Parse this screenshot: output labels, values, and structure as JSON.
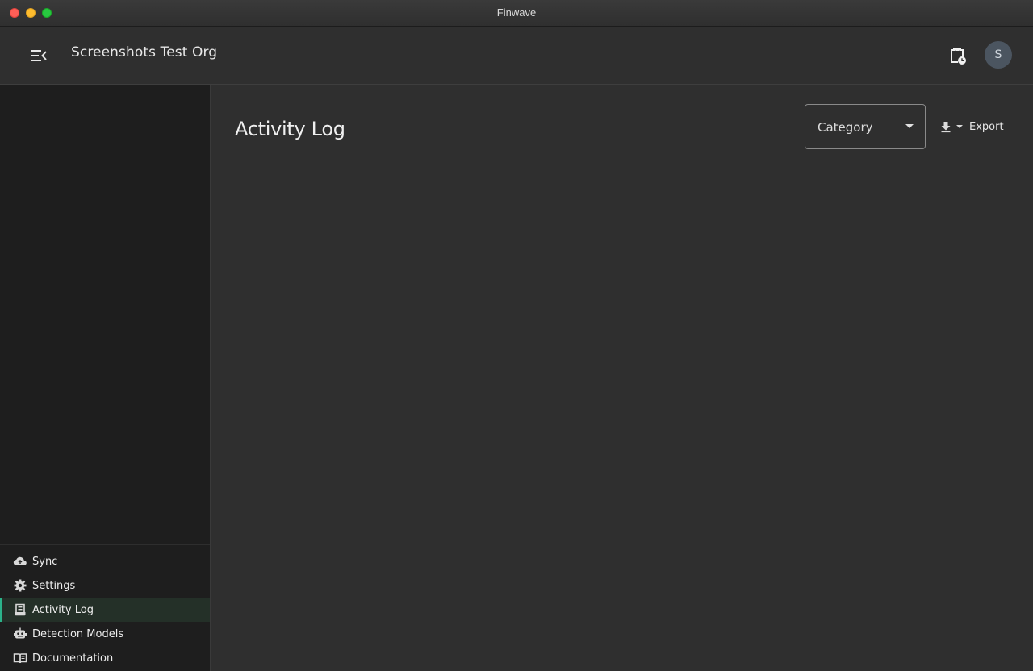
{
  "window": {
    "title": "Finwave"
  },
  "header": {
    "org_name": "Screenshots Test Org",
    "avatar_initial": "S"
  },
  "sidebar": {
    "items": [
      {
        "label": "Sync",
        "icon": "cloud-upload-icon"
      },
      {
        "label": "Settings",
        "icon": "gear-icon"
      },
      {
        "label": "Activity Log",
        "icon": "log-book-icon",
        "active": true
      },
      {
        "label": "Detection Models",
        "icon": "robot-icon"
      },
      {
        "label": "Documentation",
        "icon": "open-book-icon"
      }
    ]
  },
  "main": {
    "title": "Activity Log",
    "category_filter": {
      "label": "Category"
    },
    "export_label": "Export"
  },
  "colors": {
    "accent": "#2bb38a",
    "sidebar_bg": "#1e1e1e",
    "main_bg": "#2f2f2f",
    "avatar_bg": "#4b5560"
  }
}
